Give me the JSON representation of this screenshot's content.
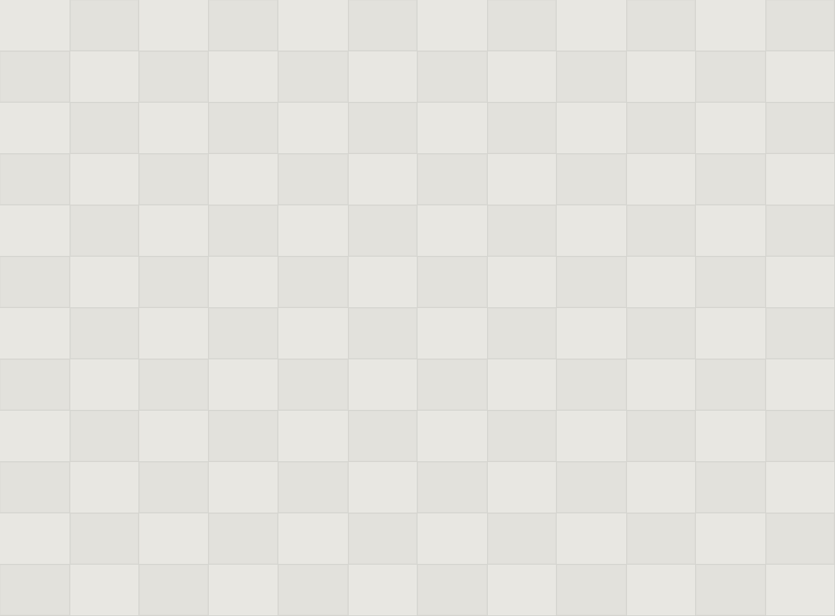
{
  "pattern": {
    "rows": 12,
    "columns": 12,
    "colors": {
      "light": "#e8e7e2",
      "dark": "#e2e1dc",
      "line": "#d3d3ce"
    }
  }
}
